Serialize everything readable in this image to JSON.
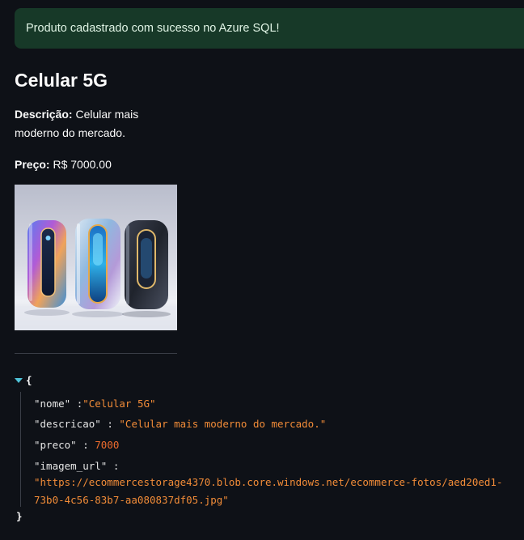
{
  "alert": {
    "message": "Produto cadastrado com sucesso no Azure SQL!"
  },
  "product": {
    "title": "Celular 5G",
    "description_label": "Descrição:",
    "description_value": "Celular mais moderno do mercado.",
    "price_label": "Preço:",
    "price_value": "R$ 7000.00",
    "image_alt": "Três celulares futuristas com acabamento metálico"
  },
  "json_view": {
    "open_brace": "{",
    "close_brace": "}",
    "colon": ":",
    "nome_key": "\"nome\"",
    "nome_value": "\"Celular 5G\"",
    "descricao_key": "\"descricao\"",
    "descricao_value": "\"Celular mais moderno do mercado.\"",
    "preco_key": "\"preco\"",
    "preco_value": "7000",
    "imagem_url_key": "\"imagem_url\"",
    "imagem_url_line1": "\"https://ecommercestorage4370.blob.core.windows.net/ecommerce-fotos/aed20ed1-",
    "imagem_url_line2": "73b0-4c56-83b7-aa080837df05.jpg\""
  },
  "colors": {
    "background": "#0e1117",
    "alert_bg": "#173928",
    "json_string": "#f28c38",
    "json_toggle": "#4fc3d8"
  }
}
